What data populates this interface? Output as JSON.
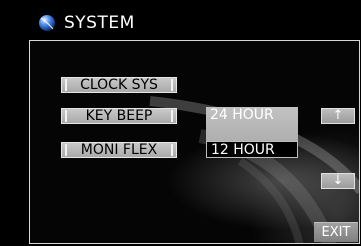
{
  "header": {
    "title": "SYSTEM",
    "logo_icon": "blue-sphere-icon"
  },
  "menu": {
    "clock_sys": "CLOCK SYS",
    "key_beep": "KEY BEEP",
    "moni_flex": "MONI FLEX"
  },
  "options": {
    "hour_24": "24 HOUR",
    "hour_12": "12 HOUR",
    "selected": "12 HOUR"
  },
  "controls": {
    "up_icon": "↑",
    "down_icon": "↓",
    "exit_label": "EXIT"
  },
  "colors": {
    "background": "#000000",
    "button": "#b8b8b8",
    "accent_logo": "#2f6bd8"
  }
}
